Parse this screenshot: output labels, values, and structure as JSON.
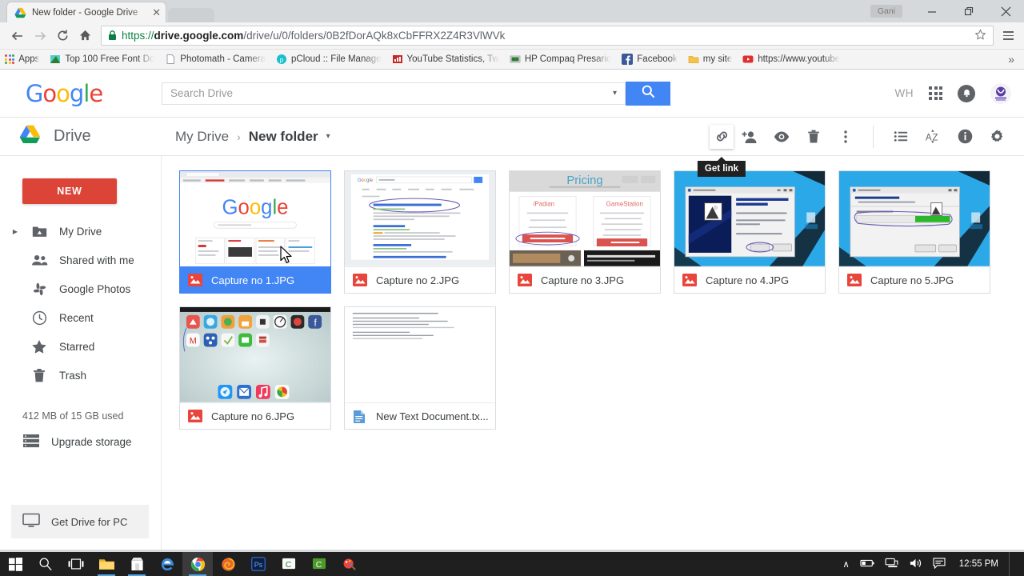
{
  "browser": {
    "tab": {
      "title": "New folder - Google Drive",
      "favicon": "drive-icon",
      "close_label": "✕"
    },
    "window_controls": {
      "profile_label": "Gani",
      "minimize": "—",
      "maximize": "❐",
      "close": "✕"
    },
    "url": {
      "scheme": "https://",
      "host": "drive.google.com",
      "path": "/drive/u/0/folders/0B2fDorAQk8xCbFFRX2Z4R3VlWVk",
      "secure": true
    },
    "bookmarks": [
      {
        "label": "Apps",
        "icon": "apps-grid-icon"
      },
      {
        "label": "Top 100 Free Font Do",
        "icon": "font-site-icon"
      },
      {
        "label": "Photomath - Camera",
        "icon": "page-icon"
      },
      {
        "label": "pCloud :: File Manage",
        "icon": "pcloud-icon"
      },
      {
        "label": "YouTube Statistics, Tw",
        "icon": "stats-icon"
      },
      {
        "label": "HP Compaq Presario",
        "icon": "hp-icon"
      },
      {
        "label": "Facebook",
        "icon": "facebook-icon"
      },
      {
        "label": "my site",
        "icon": "folder-icon"
      },
      {
        "label": "https://www.youtube",
        "icon": "youtube-icon"
      }
    ],
    "bookmarks_overflow": "»"
  },
  "drive": {
    "logo": {
      "letters": [
        "G",
        "o",
        "o",
        "g",
        "l",
        "e"
      ]
    },
    "search": {
      "placeholder": "Search Drive",
      "value": "",
      "caret": "▾",
      "button_icon": "search-icon"
    },
    "account": {
      "initials": "WH",
      "avatar_name": "user-avatar"
    },
    "brand_name": "Drive",
    "breadcrumb": {
      "root": "My Drive",
      "separator": "›",
      "current": "New folder",
      "caret": "▾"
    },
    "toolbar": {
      "left_actions": [
        {
          "name": "get-link-button",
          "icon": "link-icon",
          "active": true,
          "tooltip": "Get link"
        },
        {
          "name": "add-people-button",
          "icon": "person-add-icon",
          "active": false
        },
        {
          "name": "preview-button",
          "icon": "eye-icon",
          "active": false
        },
        {
          "name": "remove-button",
          "icon": "trash-icon",
          "active": false
        },
        {
          "name": "more-actions-button",
          "icon": "more-vert-icon",
          "active": false
        }
      ],
      "right_actions": [
        {
          "name": "list-view-button",
          "icon": "list-view-icon"
        },
        {
          "name": "sort-button",
          "icon": "sort-az-icon"
        },
        {
          "name": "details-button",
          "icon": "info-icon"
        },
        {
          "name": "settings-button",
          "icon": "gear-icon"
        }
      ]
    },
    "sidebar": {
      "new_button": "NEW",
      "items": [
        {
          "label": "My Drive",
          "icon": "my-drive-icon",
          "expandable": true
        },
        {
          "label": "Shared with me",
          "icon": "people-icon",
          "expandable": false
        },
        {
          "label": "Google Photos",
          "icon": "photos-pinwheel-icon",
          "expandable": false
        },
        {
          "label": "Recent",
          "icon": "clock-icon",
          "expandable": false
        },
        {
          "label": "Starred",
          "icon": "star-icon",
          "expandable": false
        },
        {
          "label": "Trash",
          "icon": "trash-icon",
          "expandable": false
        }
      ],
      "storage_text": "412 MB of 15 GB used",
      "upgrade_label": "Upgrade storage",
      "upgrade_icon": "storage-bars-icon",
      "get_drive_label": "Get Drive for PC",
      "get_drive_icon": "monitor-icon"
    },
    "files": [
      {
        "name": "Capture no 1.JPG",
        "type_icon": "image-icon",
        "selected": true,
        "thumb": "google-search-home"
      },
      {
        "name": "Capture no 2.JPG",
        "type_icon": "image-icon",
        "selected": false,
        "thumb": "google-results"
      },
      {
        "name": "Capture no 3.JPG",
        "type_icon": "image-icon",
        "selected": false,
        "thumb": "pricing-page"
      },
      {
        "name": "Capture no 4.JPG",
        "type_icon": "image-icon",
        "selected": false,
        "thumb": "setup-wizard"
      },
      {
        "name": "Capture no 5.JPG",
        "type_icon": "image-icon",
        "selected": false,
        "thumb": "setup-progress"
      },
      {
        "name": "Capture no 6.JPG",
        "type_icon": "image-icon",
        "selected": false,
        "thumb": "ipad-desktop"
      },
      {
        "name": "New Text Document.tx...",
        "type_icon": "text-doc-icon",
        "selected": false,
        "thumb": "text-document"
      }
    ]
  },
  "taskbar": {
    "items": [
      {
        "name": "start-button",
        "icon": "windows-icon"
      },
      {
        "name": "search-taskbar-button",
        "icon": "search-icon"
      },
      {
        "name": "task-view-button",
        "icon": "task-view-icon"
      },
      {
        "name": "file-explorer-button",
        "icon": "folder-icon",
        "running": true
      },
      {
        "name": "store-button",
        "icon": "store-icon",
        "running": true
      },
      {
        "name": "edge-button",
        "icon": "edge-icon"
      },
      {
        "name": "chrome-button",
        "icon": "chrome-icon",
        "running": true,
        "active": true
      },
      {
        "name": "firefox-button",
        "icon": "firefox-icon"
      },
      {
        "name": "photoshop-button",
        "icon": "photoshop-icon"
      },
      {
        "name": "camtasia-studio-button",
        "icon": "camtasia-icon"
      },
      {
        "name": "camtasia-recorder-button",
        "icon": "camtasia-green-icon"
      },
      {
        "name": "paint-button",
        "icon": "paint-icon"
      }
    ],
    "tray": [
      {
        "name": "show-hidden-icons-button",
        "icon": "chevron-up-icon",
        "glyph": "∧"
      },
      {
        "name": "battery-icon",
        "icon": "battery-icon"
      },
      {
        "name": "network-icon",
        "icon": "network-icon"
      },
      {
        "name": "volume-icon",
        "icon": "volume-icon"
      },
      {
        "name": "action-center-icon",
        "icon": "action-center-icon"
      }
    ],
    "time": "12:55 PM"
  }
}
